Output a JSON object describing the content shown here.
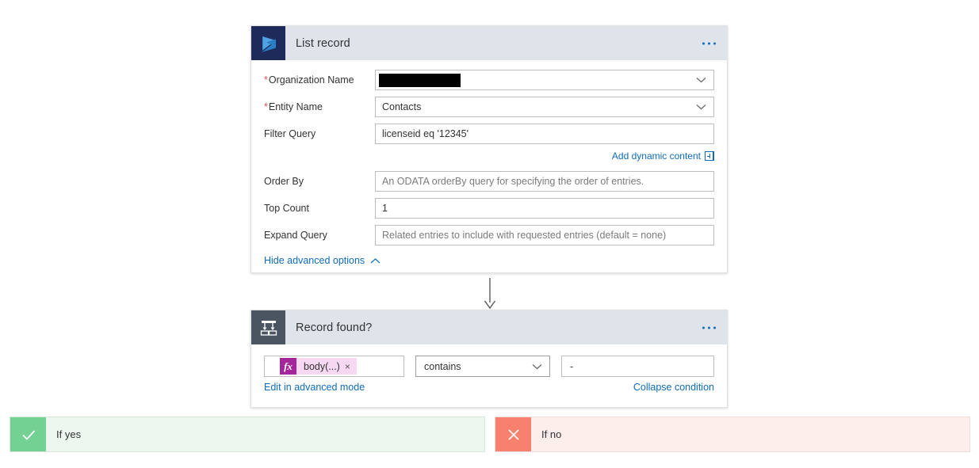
{
  "list_record_card": {
    "title": "List record",
    "icon": "dynamics365-icon",
    "menu": "ellipsis-menu",
    "fields": [
      {
        "label": "Organization Name",
        "required": true,
        "value": "",
        "redacted": true,
        "control": "dropdown"
      },
      {
        "label": "Entity Name",
        "required": true,
        "value": "Contacts",
        "redacted": false,
        "control": "dropdown"
      },
      {
        "label": "Filter Query",
        "required": false,
        "value": "licenseid eq '12345'",
        "redacted": false,
        "control": "text"
      },
      {
        "label": "Order By",
        "required": false,
        "placeholder": "An ODATA orderBy query for specifying the order of entries.",
        "redacted": false,
        "control": "text"
      },
      {
        "label": "Top Count",
        "required": false,
        "value": "1",
        "redacted": false,
        "control": "text"
      },
      {
        "label": "Expand Query",
        "required": false,
        "placeholder": "Related entries to include with requested entries (default = none)",
        "redacted": false,
        "control": "text"
      }
    ],
    "dynamic_content_link": "Add dynamic content",
    "advanced_options_link": "Hide advanced options"
  },
  "condition_card": {
    "title": "Record found?",
    "icon": "condition-icon",
    "menu": "ellipsis-menu",
    "left_token": {
      "fx": "fx",
      "label": "body(...)",
      "remove": "×"
    },
    "operator": "contains",
    "value": "-",
    "advanced_mode_link": "Edit in advanced mode",
    "collapse_link": "Collapse condition"
  },
  "branches": {
    "yes": {
      "label": "If yes",
      "icon": "checkmark-icon"
    },
    "no": {
      "label": "If no",
      "icon": "cross-icon"
    }
  },
  "colors": {
    "accent_link": "#0f6cbd",
    "header_bg": "#dfe3ea",
    "dynamics_icon_bg": "#1e2a5a",
    "condition_icon_bg": "#4a5561",
    "token_bg": "#f7d8f2",
    "token_fx_bg": "#a4269b",
    "yes_icon_bg": "#74d194",
    "yes_bar_bg": "#eef7ef",
    "no_icon_bg": "#f8806f",
    "no_bar_bg": "#fdeeec",
    "required_asterisk": "#e8475a"
  }
}
